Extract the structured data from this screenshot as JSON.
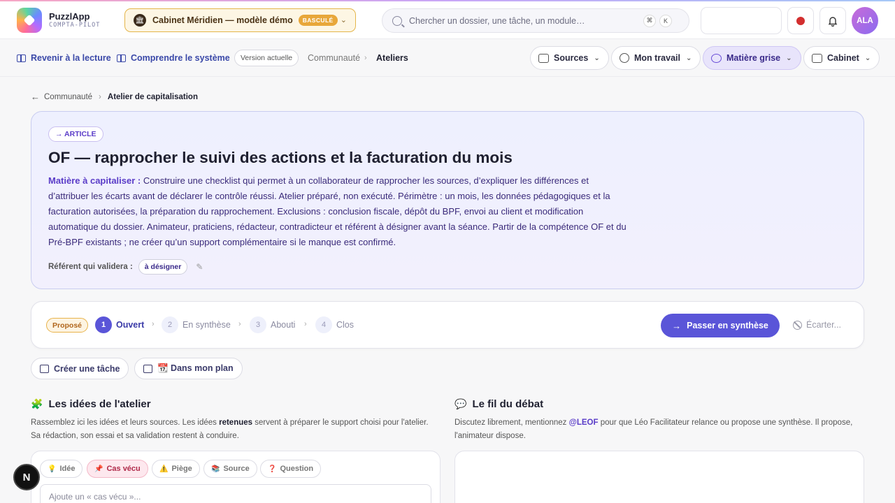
{
  "app": {
    "name": "PuzzlApp",
    "subtitle": "COMPTA-PILOT"
  },
  "cabinet": {
    "label": "Cabinet Méridien — modèle démo",
    "badge": "BASCULÉ"
  },
  "search": {
    "placeholder": "Chercher un dossier, une tâche, un module…",
    "shortcut_mod": "⌘",
    "shortcut_key": "K"
  },
  "user": {
    "initials": "ALA"
  },
  "subnav": {
    "back_label": "Revenir à la lecture",
    "understand_label": "Comprendre le système",
    "version_label": "Version actuelle",
    "crumb_parent": "Communauté",
    "crumb_current": "Ateliers",
    "menus": [
      {
        "label": "Sources"
      },
      {
        "label": "Mon travail"
      },
      {
        "label": "Matière grise"
      },
      {
        "label": "Cabinet"
      }
    ]
  },
  "breadcrumb": {
    "parent": "Communauté",
    "current": "Atelier de capitalisation"
  },
  "article": {
    "type_label": "→ ARTICLE",
    "title": "OF — rapprocher le suivi des actions et la facturation du mois",
    "body_label": "Matière à capitaliser :",
    "body_text": " Construire une checklist qui permet à un collaborateur de rapprocher les sources, d’expliquer les différences et d’attribuer les écarts avant de déclarer le contrôle réussi. Atelier préparé, non exécuté. Périmètre : un mois, les données pédagogiques et la facturation autorisées, la préparation du rapprochement. Exclusions : conclusion fiscale, dépôt du BPF, envoi au client et modification automatique du dossier. Animateur, praticiens, rédacteur, contradicteur et référent à désigner avant la séance. Partir de la compétence OF et du Pré-BPF existants ; ne créer qu’un support complémentaire si le manque est confirmé.",
    "referent_label": "Référent qui validera :",
    "referent_value": "à désigner"
  },
  "workflow": {
    "status": "Proposé",
    "steps": [
      {
        "num": "1",
        "label": "Ouvert"
      },
      {
        "num": "2",
        "label": "En synthèse"
      },
      {
        "num": "3",
        "label": "Abouti"
      },
      {
        "num": "4",
        "label": "Clos"
      }
    ],
    "primary_label": "Passer en synthèse",
    "discard_label": "Écarter..."
  },
  "actions": {
    "create_task": "Créer une tâche",
    "plan": "📆 Dans mon plan"
  },
  "ideas": {
    "title": "Les idées de l'atelier",
    "desc_pre": "Rassemblez ici les idées et leurs sources. Les idées ",
    "desc_bold": "retenues",
    "desc_post": " servent à préparer le support choisi pour l'atelier. Sa rédaction, son essai et sa validation restent à conduire.",
    "chips": [
      {
        "emoji": "💡",
        "label": "Idée"
      },
      {
        "emoji": "📌",
        "label": "Cas vécu"
      },
      {
        "emoji": "⚠️",
        "label": "Piège"
      },
      {
        "emoji": "📚",
        "label": "Source"
      },
      {
        "emoji": "❓",
        "label": "Question"
      }
    ],
    "input_placeholder": "Ajoute un « cas vécu »..."
  },
  "debate": {
    "title": "Le fil du débat",
    "desc_pre": "Discutez librement, mentionnez ",
    "mention": "@LEOF",
    "desc_post": " pour que Léo Facilitateur relance ou propose une synthèse. Il propose, l'animateur dispose."
  },
  "fab": {
    "label": "N"
  },
  "colors": {
    "accent": "#5a55d8",
    "cabinet_border": "#e4b54a",
    "status_orange": "#b0651a",
    "record_red": "#d32f2f"
  }
}
